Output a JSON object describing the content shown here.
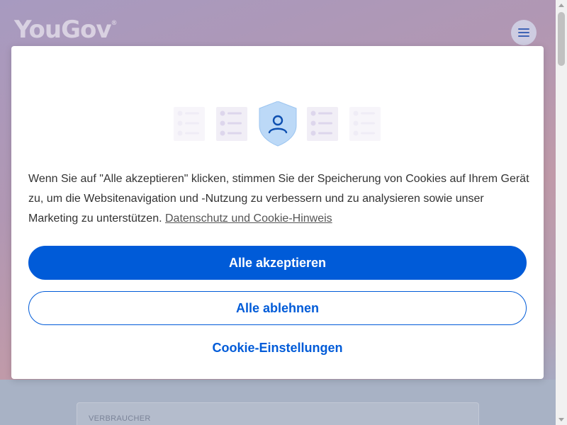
{
  "brand": {
    "logo_text": "YouGov",
    "logo_mark": "®"
  },
  "header": {
    "menu_icon": "hamburger-icon"
  },
  "background_card": {
    "label": "VERBRAUCHER"
  },
  "cookie_banner": {
    "illustration_icon": "shield-user-icon",
    "message": "Wenn Sie auf \"Alle akzeptieren\" klicken, stimmen Sie der Speicherung von Cookies auf Ihrem Gerät zu, um die Websitenavigation und -Nutzung zu verbessern und zu analysieren sowie unser Marketing zu unterstützen. ",
    "privacy_link": " Datenschutz und Cookie-Hinweis",
    "accept_label": "Alle akzeptieren",
    "reject_label": "Alle ablehnen",
    "settings_label": "Cookie-Einstellungen"
  },
  "colors": {
    "accent": "#005bd8",
    "shield_fill": "#bcd9f7",
    "list_card_fill": "#f1eef6"
  }
}
